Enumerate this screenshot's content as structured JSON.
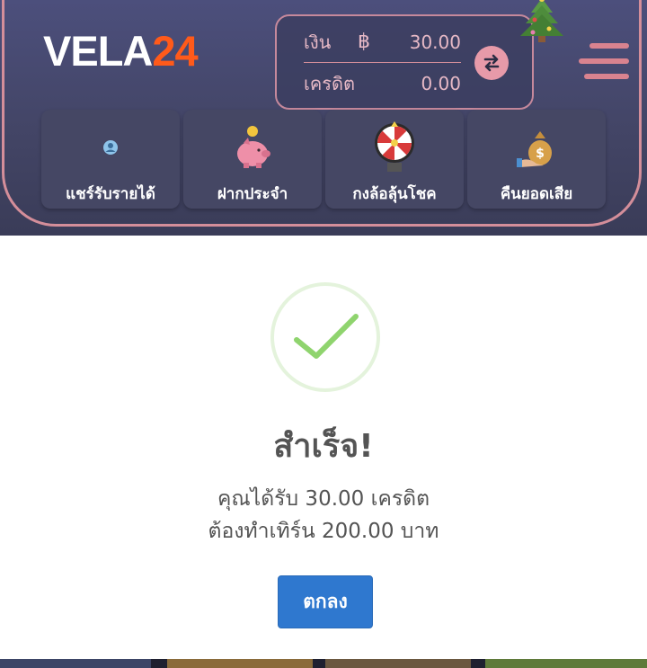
{
  "header": {
    "logo": {
      "part1": "VELA",
      "part2": "24"
    },
    "wallet": {
      "money_label": "เงิน",
      "currency_symbol": "฿",
      "money_value": "30.00",
      "credit_label": "เครดิต",
      "credit_value": "0.00"
    },
    "quick_menu": [
      {
        "label": "แชร์รับรายได้",
        "icon": "user-icon"
      },
      {
        "label": "ฝากประจำ",
        "icon": "piggy-bank-icon"
      },
      {
        "label": "กงล้อลุ้นโชค",
        "icon": "prize-wheel-icon"
      },
      {
        "label": "คืนยอดเสีย",
        "icon": "money-bag-icon"
      }
    ]
  },
  "modal": {
    "title": "สำเร็จ!",
    "line1": "คุณได้รับ 30.00 เครดิต",
    "line2": "ต้องทำเทิร์น 200.00 บาท",
    "ok_label": "ตกลง"
  },
  "colors": {
    "accent_orange": "#ff5a1a",
    "frame_pink": "#d48e9a",
    "success_green": "#8fd46e",
    "button_blue": "#2f78cf"
  }
}
